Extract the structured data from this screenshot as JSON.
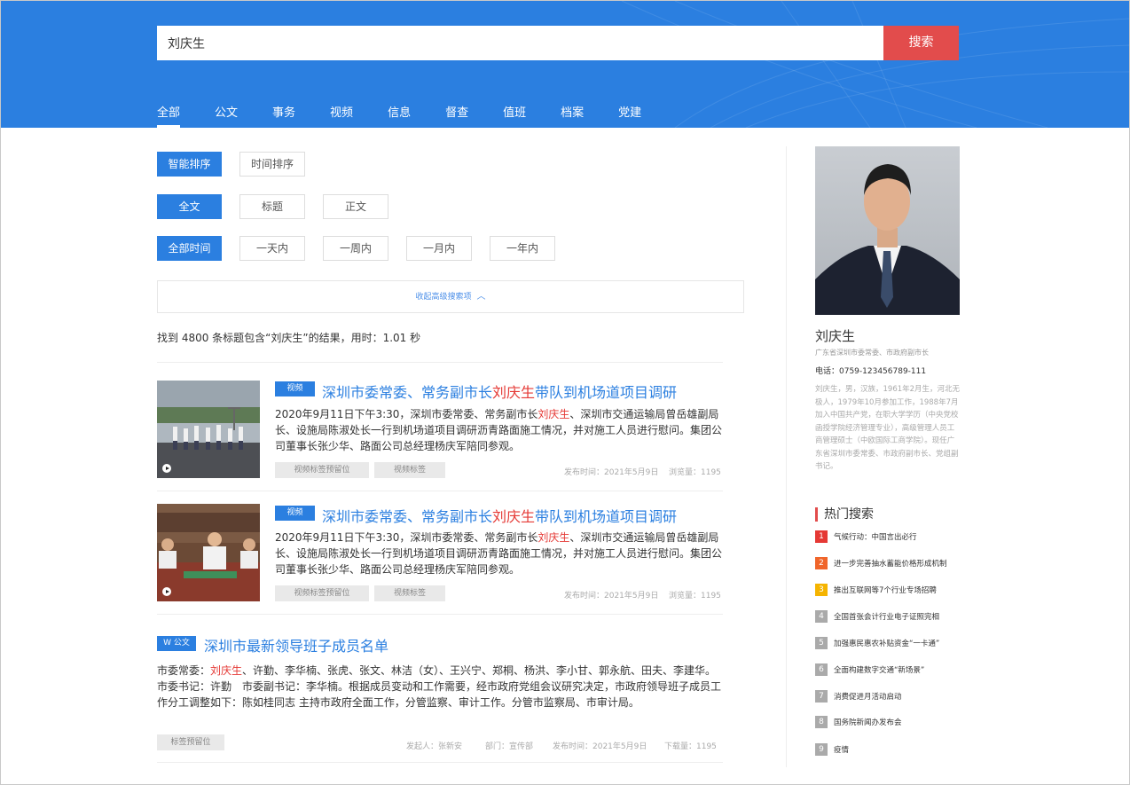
{
  "search": {
    "value": "刘庆生",
    "button_label": "搜索"
  },
  "tabs": [
    {
      "label": "全部",
      "active": true
    },
    {
      "label": "公文"
    },
    {
      "label": "事务"
    },
    {
      "label": "视频"
    },
    {
      "label": "信息"
    },
    {
      "label": "督查"
    },
    {
      "label": "值班"
    },
    {
      "label": "档案"
    },
    {
      "label": "党建"
    }
  ],
  "filters": {
    "sort": [
      "智能排序",
      "时间排序"
    ],
    "scope": [
      "全文",
      "标题",
      "正文"
    ],
    "time": [
      "全部时间",
      "一天内",
      "一周内",
      "一月内",
      "一年内"
    ],
    "collapse_label": "收起高级搜索项"
  },
  "summary": "找到 4800 条标题包含“刘庆生”的结果，用时：1.01 秒",
  "results": [
    {
      "type_badge": "视频",
      "title_pre": "深圳市委常委、常务副市长",
      "title_hl": "刘庆生",
      "title_post": "带队到机场道项目调研",
      "desc_pre": "2020年9月11日下午3:30，深圳市委常委、常务副市长",
      "desc_hl": "刘庆生",
      "desc_post": "、深圳市交通运输局曾岳雄副局长、设施局陈淑处长一行到机场道项目调研沥青路面施工情况，并对施工人员进行慰问。集团公司董事长张少华、路面公司总经理杨庆军陪同参观。",
      "tags": [
        "视频标签预留位",
        "视频标签"
      ],
      "publish": "发布时间：2021年5月9日",
      "views": "浏览量：1195"
    },
    {
      "type_badge": "视频",
      "title_pre": "深圳市委常委、常务副市长",
      "title_hl": "刘庆生",
      "title_post": "带队到机场道项目调研",
      "desc_pre": "2020年9月11日下午3:30，深圳市委常委、常务副市长",
      "desc_hl": "刘庆生",
      "desc_post": "、深圳市交通运输局曾岳雄副局长、设施局陈淑处长一行到机场道项目调研沥青路面施工情况，并对施工人员进行慰问。集团公司董事长张少华、路面公司总经理杨庆军陪同参观。",
      "tags": [
        "视频标签预留位",
        "视频标签"
      ],
      "publish": "发布时间：2021年5月9日",
      "views": "浏览量：1195"
    },
    {
      "type_badge": "W 公文",
      "title": "深圳市最新领导班子成员名单",
      "desc_pre": "市委常委：",
      "desc_hl": "刘庆生",
      "desc_post": "、许勤、李华楠、张虎、张文、林洁（女）、王兴宁、郑桐、杨洪、李小甘、郭永航、田夫、李建华。 市委书记：许勤　市委副书记：李华楠。根据成员变动和工作需要，经市政府党组会议研究决定，市政府领导班子成员工作分工调整如下：陈如桂同志 主持市政府全面工作，分管监察、审计工作。分管市监察局、市审计局。",
      "tags": [
        "标签预留位"
      ],
      "initiator": "发起人：张新安",
      "dept": "部门：宣传部",
      "publish": "发布时间：2021年5月9日",
      "downloads": "下载量：1195"
    }
  ],
  "profile": {
    "name": "刘庆生",
    "title": "广东省深圳市委常委、市政府副市长",
    "phone": "电话：0759-123456789-111",
    "bio": "刘庆生，男，汉族，1961年2月生，河北无极人，1979年10月参加工作，1988年7月加入中国共产党，在职大学学历（中央党校函授学院经济管理专业），高级管理人员工商管理硕士（中欧国际工商学院）。现任广东省深圳市委常委、市政府副市长、党组副书记。"
  },
  "hot": {
    "heading": "热门搜索",
    "items": [
      {
        "num": "1",
        "text": "气候行动：中国言出必行",
        "color": "#e53935"
      },
      {
        "num": "2",
        "text": "进一步完善抽水蓄能价格形成机制",
        "color": "#f0652a"
      },
      {
        "num": "3",
        "text": "推出互联网等7个行业专场招聘",
        "color": "#f5b400"
      },
      {
        "num": "4",
        "text": "全国首张会计行业电子证照完相",
        "color": "#aaaaaa"
      },
      {
        "num": "5",
        "text": "加强惠民惠农补贴资金“一卡通”",
        "color": "#aaaaaa"
      },
      {
        "num": "6",
        "text": "全面构建数字交通“新场景”",
        "color": "#aaaaaa"
      },
      {
        "num": "7",
        "text": "消费促进月活动启动",
        "color": "#aaaaaa"
      },
      {
        "num": "8",
        "text": "国务院新闻办发布会",
        "color": "#aaaaaa"
      },
      {
        "num": "9",
        "text": "疫情",
        "color": "#aaaaaa"
      }
    ]
  },
  "colors": {
    "primary": "#2b7fe0",
    "accent": "#e24c4c",
    "highlight": "#e53935"
  }
}
